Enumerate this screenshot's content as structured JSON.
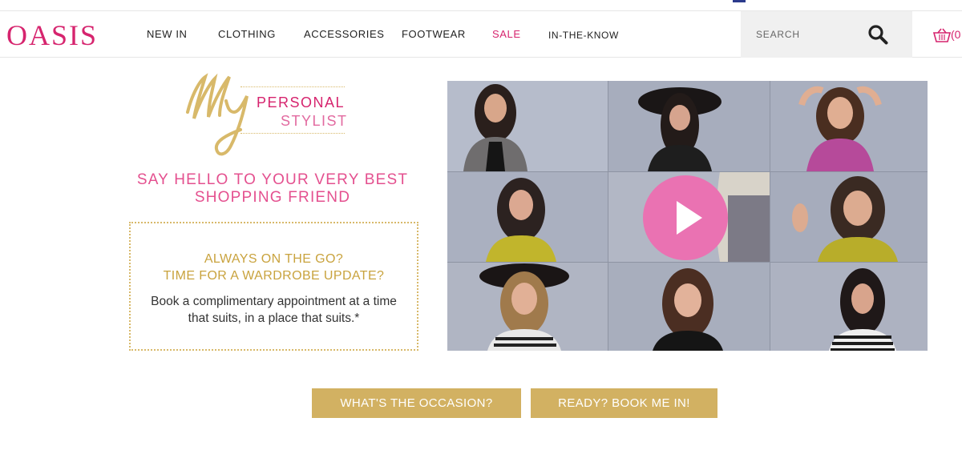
{
  "brand": {
    "logo_text": "OASIS",
    "brand_color": "#d6246e",
    "accent_gold": "#d2b162"
  },
  "nav": {
    "items": [
      {
        "label": "NEW IN"
      },
      {
        "label": "CLOTHING"
      },
      {
        "label": "ACCESSORIES"
      },
      {
        "label": "FOOTWEAR"
      },
      {
        "label": "SALE"
      },
      {
        "label": "IN-THE-KNOW"
      }
    ]
  },
  "search": {
    "placeholder": "SEARCH",
    "icon": "search-icon"
  },
  "basket": {
    "icon": "basket-icon",
    "count_text": "(0"
  },
  "promo": {
    "logo": {
      "script": "My",
      "line1": "PERSONAL",
      "line2": "STYLIST"
    },
    "headline_line1": "SAY HELLO TO YOUR VERY BEST",
    "headline_line2": "SHOPPING FRIEND",
    "box": {
      "heading_line1": "ALWAYS ON THE GO?",
      "heading_line2": "TIME FOR A WARDROBE UPDATE?",
      "body_line1": "Book a complimentary appointment at a time",
      "body_line2": "that suits, in a place that suits.*"
    }
  },
  "video": {
    "play_icon": "play-icon",
    "play_color": "#ea72b2"
  },
  "buttons": {
    "occasion": "WHAT'S THE OCCASION?",
    "book": "READY? BOOK ME IN!"
  }
}
